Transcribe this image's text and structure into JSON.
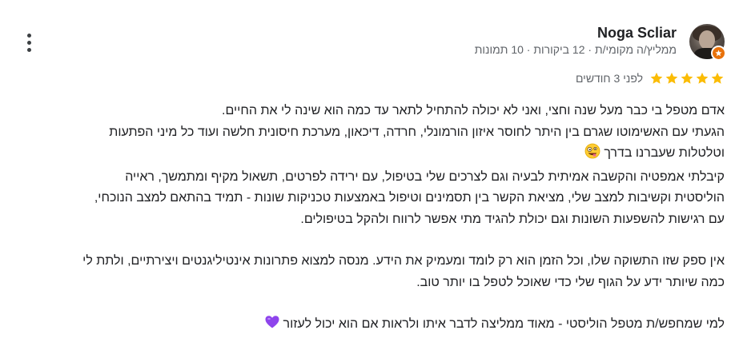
{
  "reviewer": {
    "name": "Noga Scliar",
    "meta": "ממליץ/ה מקומי/ת · 12 ביקורות · 10 תמונות"
  },
  "rating": {
    "value": 5,
    "max": 5,
    "star_color": "#fbbc04"
  },
  "time_ago": "לפני 3 חודשים",
  "body": {
    "p1_l1": "אדם מטפל בי כבר מעל שנה וחצי, ואני לא יכולה להתחיל לתאר עד כמה הוא שינה לי את החיים.",
    "p1_l2": "הגעתי עם האשימוטו שגרם בין היתר לחוסר איזון הורמונלי, חרדה, דיכאון, מערכת חיסונית חלשה ועוד כל מיני הפתעות",
    "p1_l3": "וטלטלות שעברנו בדרך",
    "p1_l3_emoji": "zany-face-emoji",
    "p1_l4": "קיבלתי אמפטיה והקשבה אמיתית לבעיה וגם לצרכים שלי בטיפול, עם ירידה לפרטים, תשאול מקיף ומתמשך, ראייה",
    "p1_l5": "הוליסטית וקשיבות למצב שלי, מציאת הקשר בין תסמינים וטיפול באמצעות טכניקות שונות - תמיד בהתאם למצב הנוכחי,",
    "p1_l6": "עם רגישות להשפעות השונות וגם יכולת להגיד מתי אפשר לרווח ולהקל בטיפולים.",
    "p2_l1": "אין ספק שזו התשוקה שלו, וכל הזמן הוא רק לומד ומעמיק את הידע. מנסה למצוא פתרונות אינטיליגנטים ויצירתיים, ולתת לי",
    "p2_l2": "כמה שיותר ידע על הגוף שלי כדי שאוכל לטפל בו יותר טוב.",
    "p3_l1": "למי שמחפש/ת מטפל הוליסטי - מאוד ממליצה לדבר איתו ולראות אם הוא יכול לעזור",
    "p3_l1_emoji": "purple-heart-emoji"
  },
  "colors": {
    "accent_star": "#fbbc04",
    "guide_badge": "#e8710a",
    "heart": "#8e44ec"
  }
}
